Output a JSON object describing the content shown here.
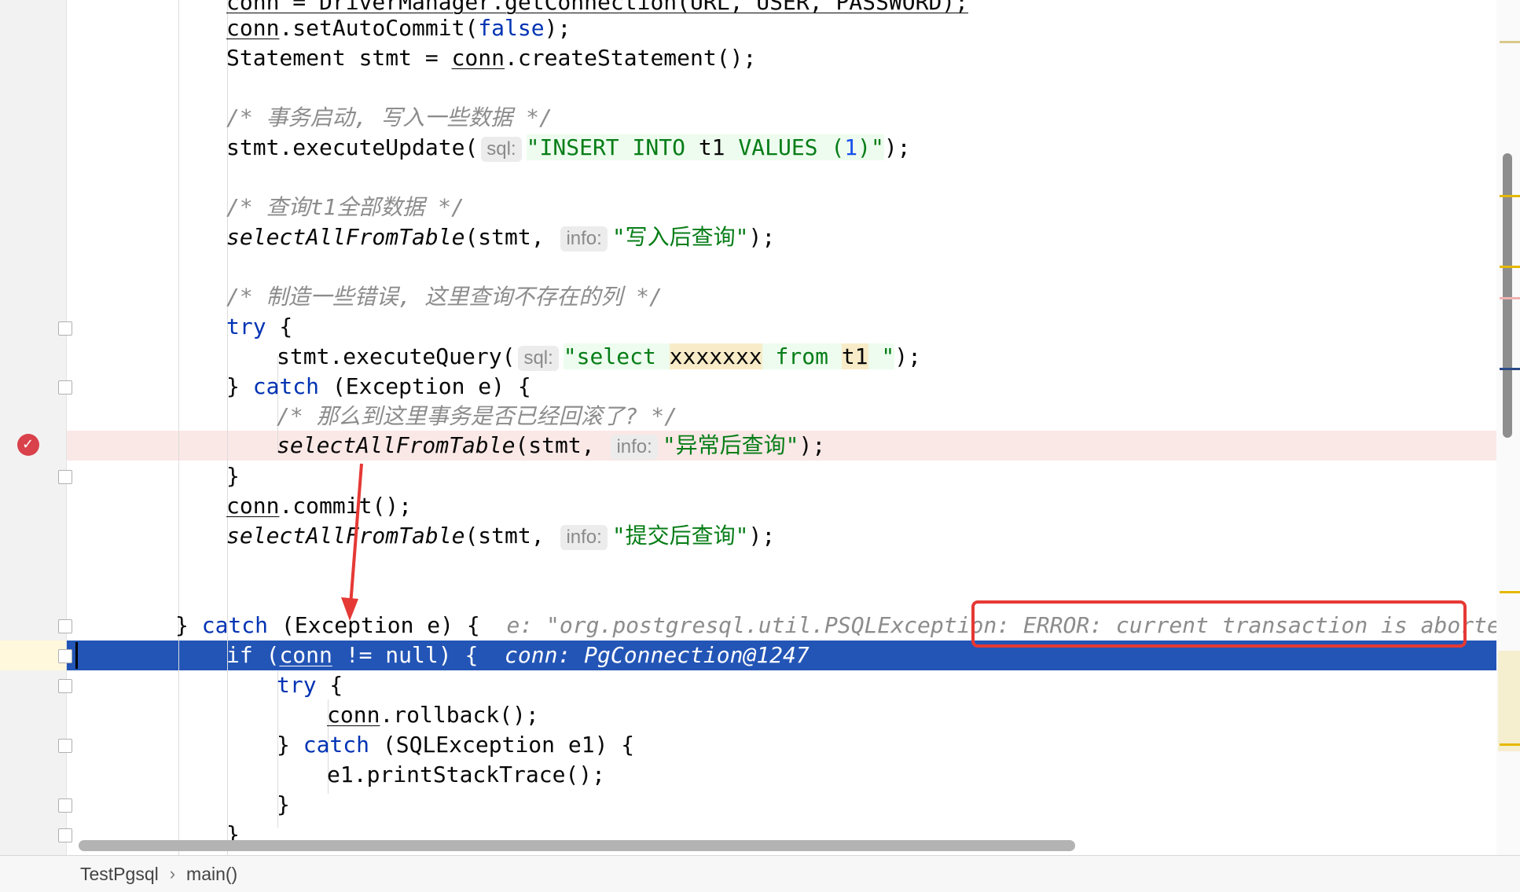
{
  "code": {
    "l0": "conn = DriverManager.getConnection(URL, USER, PASSWORD);",
    "l1_a": "conn",
    "l1_b": ".setAutoCommit(",
    "l1_c": "false",
    "l1_d": ");",
    "l2_a": "Statement stmt = ",
    "l2_b": "conn",
    "l2_c": ".createStatement();",
    "c1": "/* 事务启动, 写入一些数据 */",
    "l4_a": "stmt.executeUpdate(",
    "l4_hint": "sql:",
    "l4_s1": "\"INSERT INTO ",
    "l4_s2": "t1",
    "l4_s3": " VALUES (",
    "l4_n": "1",
    "l4_s4": ")\"",
    "l4_end": ");",
    "c2": "/* 查询t1全部数据 */",
    "l6_fn": "selectAllFromTable",
    "l6_a": "(stmt, ",
    "l6_hint": "info:",
    "l6_s": "\"写入后查询\"",
    "l6_end": ");",
    "c3": "/* 制造一些错误, 这里查询不存在的列 */",
    "try1": "try",
    "brace_open": " {",
    "l9_a": "stmt.executeQuery(",
    "l9_hint": "sql:",
    "l9_s1": "\"select ",
    "l9_s2": "xxxxxxx",
    "l9_s3": " from ",
    "l9_s4": "t1",
    "l9_s5": " \"",
    "l9_end": ");",
    "l10_a": "} ",
    "l10_kw": "catch",
    "l10_b": " (Exception e) {",
    "c4": "/* 那么到这里事务是否已经回滚了? */",
    "l12_fn": "selectAllFromTable",
    "l12_a": "(stmt, ",
    "l12_hint": "info:",
    "l12_s": "\"异常后查询\"",
    "l12_end": ");",
    "l13": "}",
    "l14_a": "conn",
    "l14_b": ".commit();",
    "l15_fn": "selectAllFromTable",
    "l15_a": "(stmt, ",
    "l15_hint": "info:",
    "l15_s": "\"提交后查询\"",
    "l15_end": ");",
    "l17_a": "} ",
    "l17_kw": "catch",
    "l17_b": " (Exception e) {",
    "l17_dbg": "e: \"org.postgresql.util.PSQLException: ERROR: current transaction is aborted, comm",
    "l18_kw": "if",
    "l18_a": " (",
    "l18_u": "conn",
    "l18_b": " != null) {",
    "l18_dbg": "conn: PgConnection@1247",
    "l19_kw": "try",
    "l19_b": " {",
    "l20_u": "conn",
    "l20_b": ".rollback();",
    "l21_a": "} ",
    "l21_kw": "catch",
    "l21_b": " (SQLException e1) {",
    "l22": "e1.printStackTrace();",
    "l23": "}",
    "l24": "}"
  },
  "breadcrumb": {
    "file": "TestPgsql",
    "sep": "›",
    "method": "main()"
  },
  "colors": {
    "keyword": "#0033b3",
    "string": "#067d17",
    "comment": "#8c8c8c",
    "execution_line": "#2355b6",
    "breakpoint_line": "#fae8e6",
    "breakpoint": "#d9414b",
    "annotation": "#e53935"
  },
  "icons": [
    "breakpoint-icon",
    "fold-marker-icon",
    "annotation-arrow"
  ]
}
